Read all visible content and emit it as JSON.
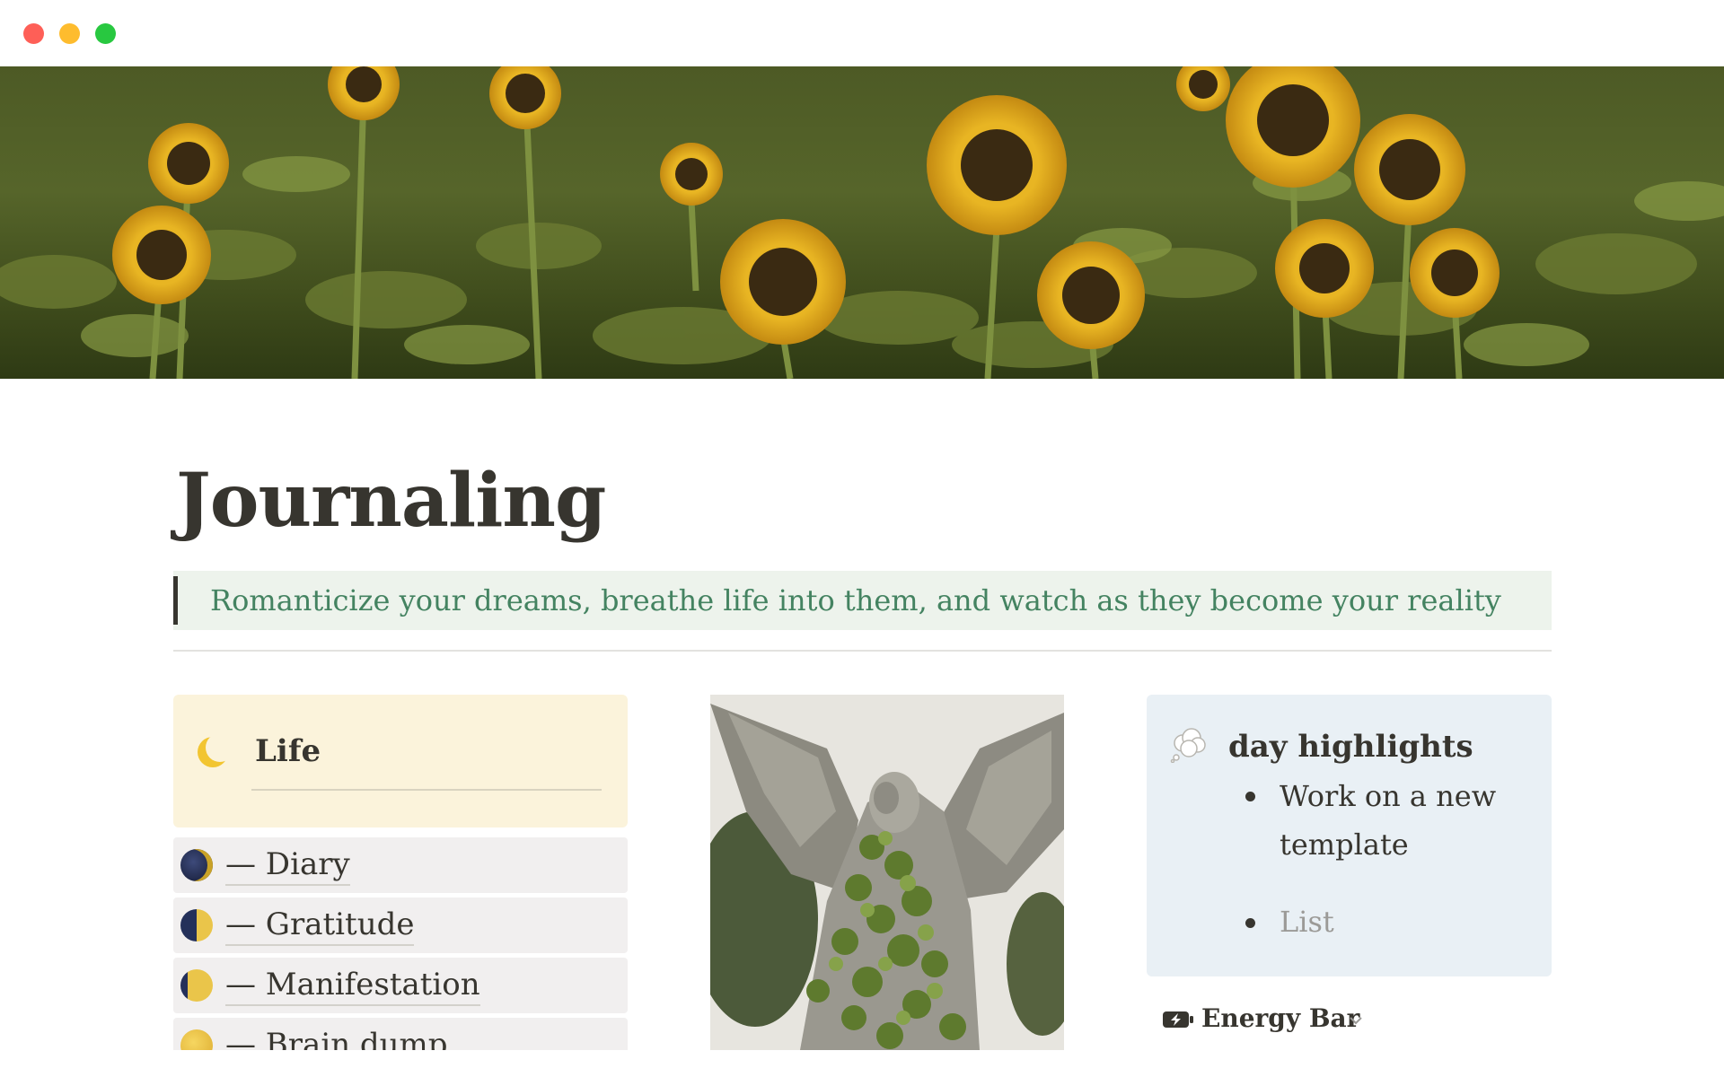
{
  "window": {
    "controls": [
      "close",
      "minimize",
      "zoom"
    ]
  },
  "cover": {
    "icon": "sunflower-field-photo"
  },
  "page": {
    "title": "Journaling",
    "quote": "Romanticize your dreams, breathe life into them, and watch as they become your reality"
  },
  "life": {
    "icon": "crescent-moon-icon",
    "title": "Life",
    "links": [
      {
        "label": "— Diary",
        "icon": "new-moon-icon"
      },
      {
        "label": "— Gratitude",
        "icon": "first-quarter-moon-icon"
      },
      {
        "label": "— Manifestation",
        "icon": "waxing-gibbous-moon-icon"
      },
      {
        "label": "— Brain dump",
        "icon": "full-moon-icon"
      }
    ]
  },
  "image": {
    "icon": "angel-statue-photo"
  },
  "highlights": {
    "icon": "thought-balloon-icon",
    "title": "day highlights",
    "items": [
      "Work on a new template"
    ],
    "placeholder": "List"
  },
  "energy": {
    "icon": "battery-charging-icon",
    "label": "Energy Bar"
  },
  "colors": {
    "quote_bg": "#edf3ec",
    "quote_text": "#448361",
    "life_bg": "#fbf3db",
    "link_bg": "#f1efef",
    "highlights_bg": "#e9f0f5"
  }
}
